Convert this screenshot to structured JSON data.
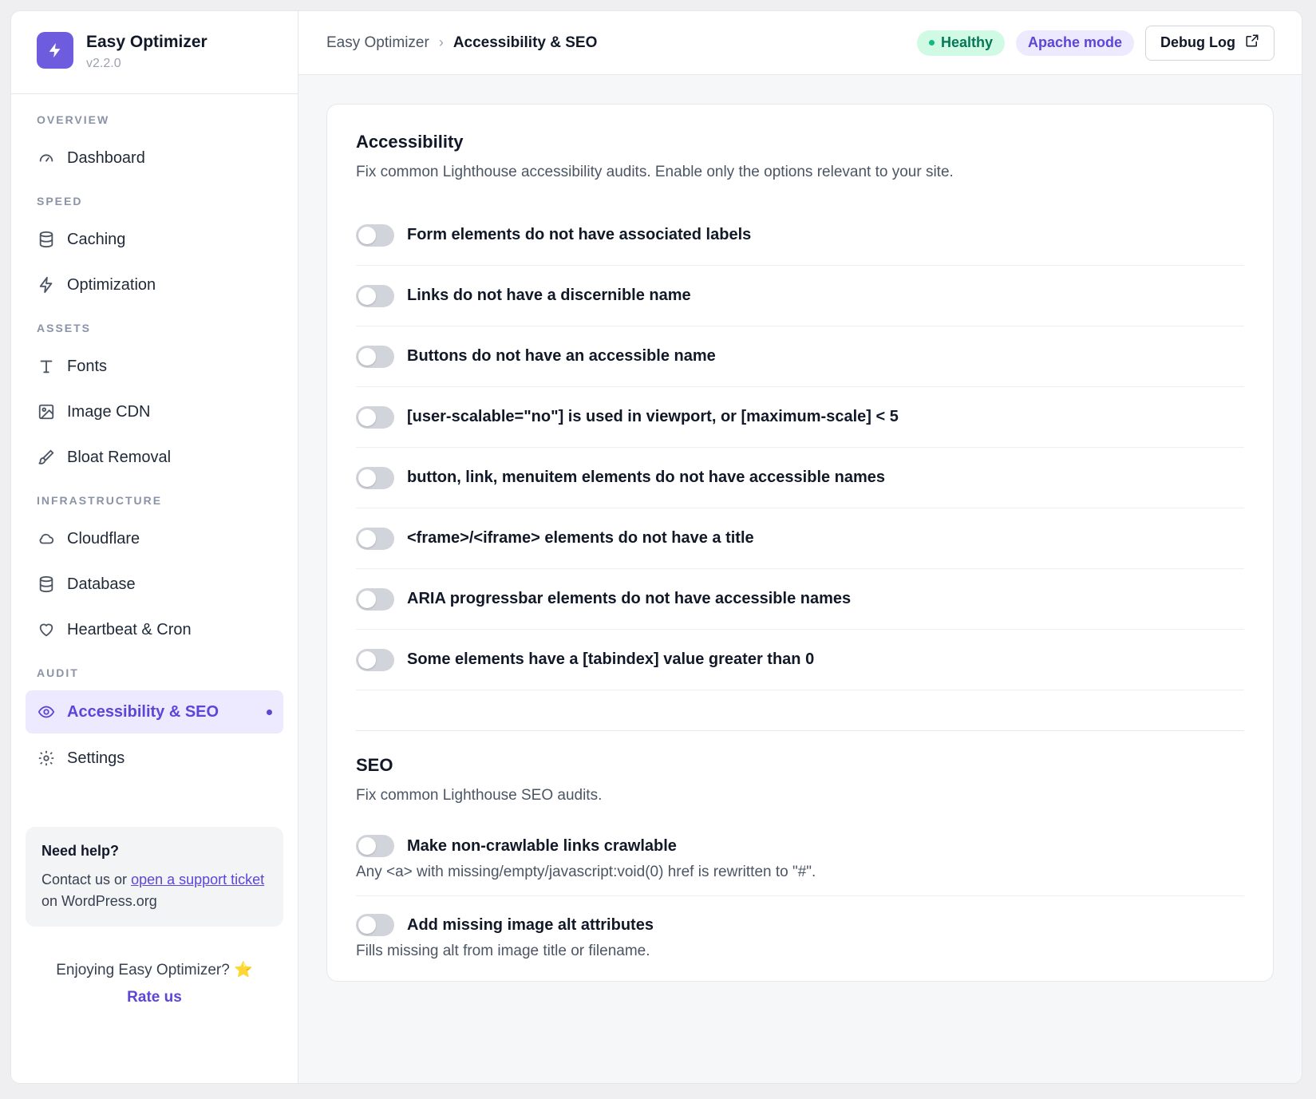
{
  "brand": {
    "name": "Easy Optimizer",
    "version": "v2.2.0"
  },
  "sidebar": {
    "sections": [
      {
        "title": "OVERVIEW",
        "items": [
          {
            "label": "Dashboard",
            "icon": "gauge-icon"
          }
        ]
      },
      {
        "title": "SPEED",
        "items": [
          {
            "label": "Caching",
            "icon": "database-icon"
          },
          {
            "label": "Optimization",
            "icon": "lightning-icon"
          }
        ]
      },
      {
        "title": "ASSETS",
        "items": [
          {
            "label": "Fonts",
            "icon": "type-icon"
          },
          {
            "label": "Image CDN",
            "icon": "image-icon"
          },
          {
            "label": "Bloat Removal",
            "icon": "brush-icon"
          }
        ]
      },
      {
        "title": "INFRASTRUCTURE",
        "items": [
          {
            "label": "Cloudflare",
            "icon": "cloud-icon"
          },
          {
            "label": "Database",
            "icon": "database-icon"
          },
          {
            "label": "Heartbeat & Cron",
            "icon": "heart-icon"
          }
        ]
      },
      {
        "title": "AUDIT",
        "items": [
          {
            "label": "Accessibility & SEO",
            "icon": "eye-icon",
            "active": true
          }
        ]
      }
    ],
    "settings_label": "Settings",
    "help": {
      "title": "Need help?",
      "text_before": "Contact us or ",
      "link_text": "open a support ticket",
      "text_after": " on WordPress.org"
    },
    "rate": {
      "text": "Enjoying Easy Optimizer? ⭐",
      "link": "Rate us"
    }
  },
  "header": {
    "breadcrumb_root": "Easy Optimizer",
    "breadcrumb_sep": "›",
    "breadcrumb_current": "Accessibility & SEO",
    "status_badge": "Healthy",
    "mode_badge": "Apache mode",
    "debug_button": "Debug Log"
  },
  "accessibility": {
    "title": "Accessibility",
    "description": "Fix common Lighthouse accessibility audits. Enable only the options relevant to your site.",
    "options": [
      {
        "label": "Form elements do not have associated labels",
        "enabled": false
      },
      {
        "label": "Links do not have a discernible name",
        "enabled": false
      },
      {
        "label": "Buttons do not have an accessible name",
        "enabled": false
      },
      {
        "label": "[user-scalable=\"no\"] is used in viewport, or [maximum-scale] < 5",
        "enabled": false
      },
      {
        "label": "button, link, menuitem elements do not have accessible names",
        "enabled": false
      },
      {
        "label": "<frame>/<iframe> elements do not have a title",
        "enabled": false
      },
      {
        "label": "ARIA progressbar elements do not have accessible names",
        "enabled": false
      },
      {
        "label": "Some elements have a [tabindex] value greater than 0",
        "enabled": false
      }
    ]
  },
  "seo": {
    "title": "SEO",
    "description": "Fix common Lighthouse SEO audits.",
    "options": [
      {
        "label": "Make non-crawlable links crawlable",
        "help": "Any <a> with missing/empty/javascript:void(0) href is rewritten to \"#\".",
        "enabled": false
      },
      {
        "label": "Add missing image alt attributes",
        "help": "Fills missing alt from image title or filename.",
        "enabled": false
      }
    ]
  },
  "colors": {
    "accent": "#5b46d8",
    "brand": "#6d5dde",
    "healthy_bg": "#d1fae5",
    "healthy_text": "#047857",
    "toggle_off": "#d1d5db"
  }
}
